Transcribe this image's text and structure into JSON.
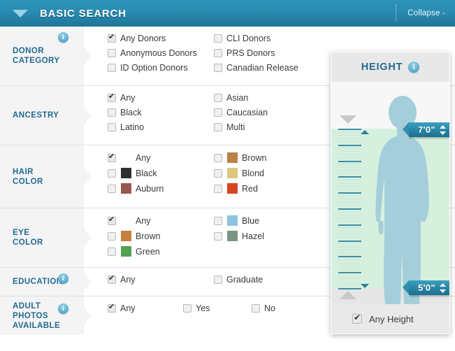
{
  "header": {
    "title": "BASIC SEARCH",
    "collapse_label": "Collapse -",
    "caret_icon": "triangle-down-icon"
  },
  "rows": [
    {
      "key": "donor_category",
      "label": "DONOR CATEGORY",
      "has_info": true,
      "columns": 2,
      "options": [
        {
          "label": "Any Donors",
          "checked": true
        },
        {
          "label": "CLI Donors",
          "checked": false
        },
        {
          "label": "Anonymous Donors",
          "checked": false
        },
        {
          "label": "PRS Donors",
          "checked": false
        },
        {
          "label": "ID Option Donors",
          "checked": false
        },
        {
          "label": "Canadian Release",
          "checked": false
        }
      ]
    },
    {
      "key": "ancestry",
      "label": "ANCESTRY",
      "has_info": false,
      "columns": 2,
      "options": [
        {
          "label": "Any",
          "checked": true
        },
        {
          "label": "Asian",
          "checked": false
        },
        {
          "label": "Black",
          "checked": false
        },
        {
          "label": "Caucasian",
          "checked": false
        },
        {
          "label": "Latino",
          "checked": false
        },
        {
          "label": "Multi",
          "checked": false
        }
      ]
    },
    {
      "key": "hair_color",
      "label": "HAIR COLOR",
      "has_info": false,
      "columns": 2,
      "options": [
        {
          "label": "Any",
          "checked": true,
          "swatch": null
        },
        {
          "label": "Brown",
          "checked": false,
          "swatch": "#bb8148"
        },
        {
          "label": "Black",
          "checked": false,
          "swatch": "#2e3030"
        },
        {
          "label": "Blond",
          "checked": false,
          "swatch": "#ddc782"
        },
        {
          "label": "Auburn",
          "checked": false,
          "swatch": "#96584f"
        },
        {
          "label": "Red",
          "checked": false,
          "swatch": "#d64420"
        }
      ]
    },
    {
      "key": "eye_color",
      "label": "EYE COLOR",
      "has_info": false,
      "columns": 2,
      "options": [
        {
          "label": "Any",
          "checked": true,
          "swatch": null
        },
        {
          "label": "Blue",
          "checked": false,
          "swatch": "#8cc3de"
        },
        {
          "label": "Brown",
          "checked": false,
          "swatch": "#c4803c"
        },
        {
          "label": "Hazel",
          "checked": false,
          "swatch": "#799484"
        },
        {
          "label": "Green",
          "checked": false,
          "swatch": "#53a056"
        }
      ]
    },
    {
      "key": "education",
      "label": "EDUCATION",
      "has_info": true,
      "columns": 2,
      "options": [
        {
          "label": "Any",
          "checked": true
        },
        {
          "label": "Graduate",
          "checked": false
        }
      ]
    },
    {
      "key": "adult_photos_available",
      "label": "ADULT PHOTOS AVAILABLE",
      "has_info": true,
      "columns": 3,
      "options": [
        {
          "label": "Any",
          "checked": true
        },
        {
          "label": "Yes",
          "checked": false
        },
        {
          "label": "No",
          "checked": false
        }
      ]
    }
  ],
  "height_panel": {
    "title": "HEIGHT",
    "has_info": true,
    "max_value": "7'0\"",
    "min_value": "5'0\"",
    "spinner_icon": "up-down-arrows-icon",
    "top_handle_icon": "triangle-down-handle-icon",
    "bottom_handle_icon": "triangle-up-handle-icon",
    "top_marker_icon": "triangle-up-marker-icon",
    "bottom_marker_icon": "triangle-down-marker-icon",
    "silhouette_icon": "person-silhouette-icon",
    "any_height": {
      "label": "Any Height",
      "checked": true
    },
    "ruler": {
      "major_tick_color": "#3d8fa8",
      "minor_tick_color": "#cfe6d6",
      "major_tick_count": 10,
      "minor_ticks_between": 5
    },
    "colors": {
      "range_fill": "#d6f0de",
      "silhouette": "#a4ceda",
      "badge": "#2a87a8"
    }
  }
}
